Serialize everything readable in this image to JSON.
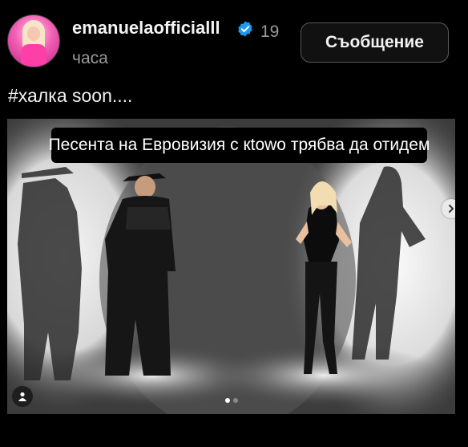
{
  "post": {
    "username": "emanuelaofficialll",
    "time_line1": "19",
    "time_line2": "часа",
    "message_button": "Съобщение",
    "caption": "#халка soon....",
    "subtitle": "Песента на Евровизия с кtowo трябва да отидем"
  },
  "carousel": {
    "slide_count": 2,
    "current_slide": 1
  },
  "icons": {
    "verified": "verified-badge-icon",
    "next": "chevron-right-icon",
    "tag": "user-tag-icon"
  },
  "colors": {
    "background": "#000000",
    "verified": "#1d9bf0",
    "muted_text": "#9a9a9a"
  }
}
